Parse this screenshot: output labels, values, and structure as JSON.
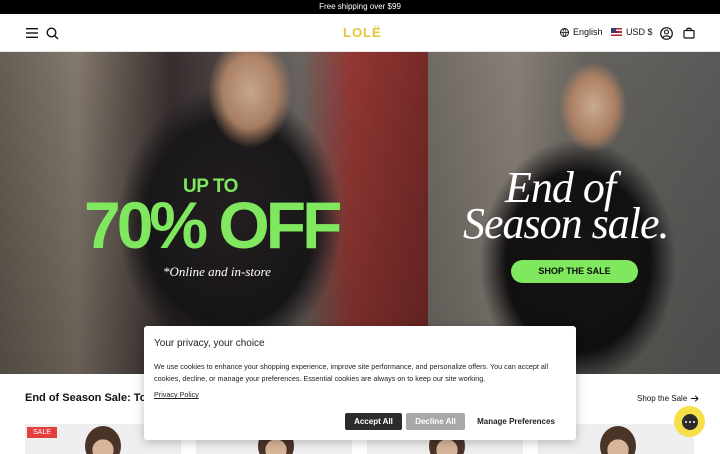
{
  "announcement": "Free shipping over $99",
  "header": {
    "logo": "LOLË",
    "language": "English",
    "currency": "USD $",
    "icons": [
      "menu-icon",
      "search-icon",
      "globe-icon",
      "us-flag-icon",
      "account-icon",
      "bag-icon"
    ]
  },
  "hero": {
    "left": {
      "up_to": "UP TO",
      "discount": "70% OFF",
      "note": "*Online and in-store"
    },
    "right": {
      "line1": "End of",
      "line2": "Season sale.",
      "cta": "SHOP THE SALE"
    }
  },
  "section": {
    "title": "End of Season Sale: Too Ho",
    "link": "Shop the Sale"
  },
  "products": [
    {
      "badge": "SALE"
    },
    {
      "badge": ""
    },
    {
      "badge": ""
    },
    {
      "badge": ""
    }
  ],
  "cookie_banner": {
    "title": "Your privacy, your choice",
    "text": "We use cookies to enhance your shopping experience, improve site performance, and personalize offers. You can accept all cookies, decline, or manage your preferences. Essential cookies are always on to keep our site working.",
    "policy_link": "Privacy Policy",
    "accept": "Accept All",
    "decline": "Decline All",
    "manage": "Manage Preferences"
  },
  "colors": {
    "accent_green": "#7fe85e",
    "logo_yellow": "#e5c63a",
    "sale_red": "#e43f3f",
    "chat_yellow": "#f5e04a"
  }
}
